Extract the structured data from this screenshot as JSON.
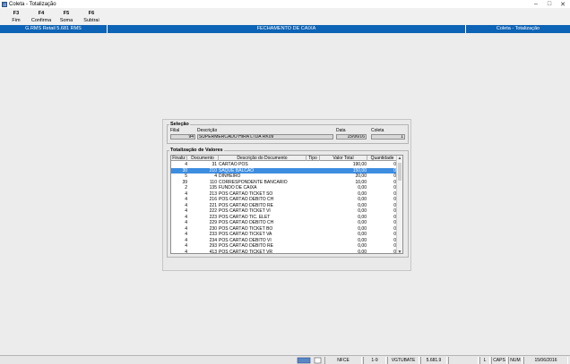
{
  "window": {
    "title": "Coleta - Totalização",
    "minimize": "–",
    "maximize": "□",
    "close": "✕"
  },
  "toolbar": [
    {
      "key": "F3",
      "label": "Fim"
    },
    {
      "key": "F4",
      "label": "Confirma"
    },
    {
      "key": "F5",
      "label": "Soma"
    },
    {
      "key": "F6",
      "label": "Subtrai"
    }
  ],
  "header": {
    "left": "G.RMS Retail 5.681 RMS",
    "center": "FECHAMENTO DE CAIXA",
    "right": "Coleta - Totalização"
  },
  "selecao": {
    "title": "Seleção",
    "filial_label": "Filial",
    "filial": "94",
    "descricao_label": "Descrição",
    "descricao": "SUPERMERCADO HIRA LTDA RK09",
    "data_label": "Data",
    "data": "15/06/16",
    "coleta_label": "Coleta",
    "coleta": "1"
  },
  "totalizacao": {
    "title": "Totalização de Valores",
    "columns": [
      "Finaliz",
      "Documento",
      "Descrição do Documento",
      "Tipo",
      "Valor Total",
      "Quantidade"
    ],
    "rows": [
      [
        "4",
        "31",
        "CARTÃO POS",
        "",
        "190,00",
        "0"
      ],
      [
        "30",
        "210",
        "SAQUE BALCAO",
        "",
        "150,00",
        "0"
      ],
      [
        "5",
        "4",
        "DINHEIRO",
        "",
        "20,00",
        "0"
      ],
      [
        "39",
        "110",
        "CORRESPONDENTE BANCARIO",
        "",
        "10,00",
        "0"
      ],
      [
        "2",
        "135",
        "FUNDO DE CAIXA",
        "",
        "0,00",
        "0"
      ],
      [
        "4",
        "213",
        "POS CARTÃO TICKET SO",
        "",
        "0,00",
        "0"
      ],
      [
        "4",
        "216",
        "POS CARTÃO DÉBITO CH",
        "",
        "0,00",
        "0"
      ],
      [
        "4",
        "221",
        "POS CARTÃO DÉBITO RE",
        "",
        "0,00",
        "0"
      ],
      [
        "4",
        "222",
        "POS CARTÃO TICKET VI",
        "",
        "0,00",
        "0"
      ],
      [
        "4",
        "223",
        "POS CARTÃO TIC. ELET",
        "",
        "0,00",
        "0"
      ],
      [
        "4",
        "229",
        "POS CARTÃO DÉBITO CH",
        "",
        "0,00",
        "0"
      ],
      [
        "4",
        "230",
        "POS CARTÃO TICKET BO",
        "",
        "0,00",
        "0"
      ],
      [
        "4",
        "233",
        "POS CARTÃO TICKET VA",
        "",
        "0,00",
        "0"
      ],
      [
        "4",
        "234",
        "POS CARTÃO DÉBITO VI",
        "",
        "0,00",
        "0"
      ],
      [
        "4",
        "293",
        "POS CARTÃO DÉBITO RE",
        "",
        "0,00",
        "0"
      ],
      [
        "4",
        "413",
        "POS CARTÃO TICKET VR",
        "",
        "0,00",
        "0"
      ]
    ],
    "selected_index": 1
  },
  "status": {
    "items": [
      "NFCE",
      "1-9",
      "VGTUBATE",
      "5.681.9",
      "L",
      "CAPS",
      "NUM",
      "15/06/2016"
    ]
  }
}
